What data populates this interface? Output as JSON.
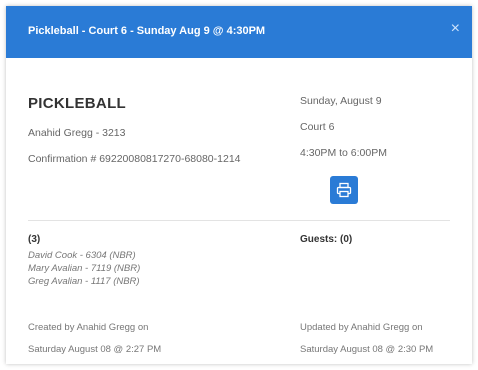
{
  "header": {
    "title": "Pickleball - Court 6 - Sunday Aug 9 @ 4:30PM",
    "close_label": "×"
  },
  "booking": {
    "sport": "PICKLEBALL",
    "owner": "Anahid Gregg - 3213",
    "confirmation": "Confirmation # 69220080817270-68080-1214",
    "date": "Sunday, August 9",
    "court": "Court 6",
    "time": "4:30PM to 6:00PM"
  },
  "players": {
    "count_label": "(3)",
    "guests_label": "Guests: (0)",
    "list": [
      "David Cook - 6304 (NBR)",
      "Mary Avalian - 7119 (NBR)",
      "Greg Avalian - 1117 (NBR)"
    ]
  },
  "footer": {
    "created_by": "Created by Anahid Gregg on",
    "created_on": "Saturday August 08 @ 2:27 PM",
    "updated_by": "Updated by Anahid Gregg on",
    "updated_on": "Saturday August 08 @ 2:30 PM"
  },
  "colors": {
    "header_bg": "#2a7bd6",
    "button_bg": "#2a7bd6"
  },
  "icons": {
    "print": "print-icon",
    "close": "close-icon"
  }
}
